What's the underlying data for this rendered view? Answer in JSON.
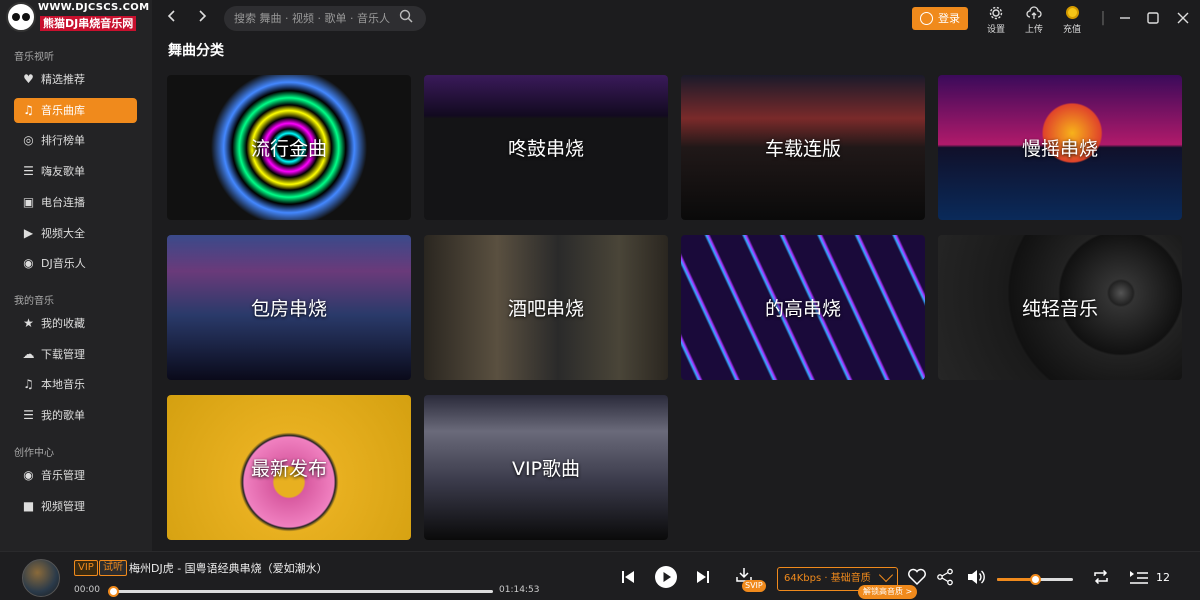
{
  "logo": {
    "url": "WWW.DJCSCS.COM",
    "name": "熊猫DJ串烧音乐网"
  },
  "sidebar": {
    "sections": [
      {
        "title": "音乐视听",
        "items": [
          {
            "label": "精选推荐",
            "icon": "heart-diamond-icon"
          },
          {
            "label": "音乐曲库",
            "icon": "music-note-icon",
            "active": true
          },
          {
            "label": "排行榜单",
            "icon": "medal-icon"
          },
          {
            "label": "嗨友歌单",
            "icon": "playlist-icon"
          },
          {
            "label": "电台连播",
            "icon": "radio-icon"
          },
          {
            "label": "视频大全",
            "icon": "video-icon"
          },
          {
            "label": "DJ音乐人",
            "icon": "turntable-icon"
          }
        ]
      },
      {
        "title": "我的音乐",
        "items": [
          {
            "label": "我的收藏",
            "icon": "star-icon"
          },
          {
            "label": "下载管理",
            "icon": "cloud-download-icon"
          },
          {
            "label": "本地音乐",
            "icon": "music-note-icon"
          },
          {
            "label": "我的歌单",
            "icon": "playlist-icon"
          }
        ]
      },
      {
        "title": "创作中心",
        "items": [
          {
            "label": "音乐管理",
            "icon": "disc-icon"
          },
          {
            "label": "视频管理",
            "icon": "camera-icon"
          }
        ]
      }
    ]
  },
  "topbar": {
    "search_placeholder": "搜索 舞曲 · 视频 · 歌单 · 音乐人",
    "login_label": "登录",
    "tools": [
      {
        "label": "设置",
        "icon": "gear-icon"
      },
      {
        "label": "上传",
        "icon": "upload-cloud-icon"
      },
      {
        "label": "充值",
        "icon": "coin-icon"
      }
    ]
  },
  "main": {
    "title": "舞曲分类",
    "categories": [
      {
        "label": "流行金曲",
        "theme": "neon-rings"
      },
      {
        "label": "咚鼓串烧",
        "theme": "purple-stage"
      },
      {
        "label": "车载连版",
        "theme": "car-sunset"
      },
      {
        "label": "慢摇串烧",
        "theme": "retro-sun-grid"
      },
      {
        "label": "包房串烧",
        "theme": "club-crowd"
      },
      {
        "label": "酒吧串烧",
        "theme": "bar-bottles"
      },
      {
        "label": "的高串烧",
        "theme": "neon-stripes"
      },
      {
        "label": "纯轻音乐",
        "theme": "vinyl-record"
      },
      {
        "label": "最新发布",
        "theme": "donut-pop"
      },
      {
        "label": "VIP歌曲",
        "theme": "concert-stage"
      }
    ]
  },
  "player": {
    "vip_tag": "VIP",
    "trial_tag": "试听",
    "song": "梅州DJ虎 - 国粤语经典串烧（爱如潮水）",
    "current_time": "00:00",
    "duration": "01:14:53",
    "progress": 0,
    "svip_badge": "SVIP",
    "quality": "64Kbps · 基础音质",
    "unlock_label": "解锁高音质 >",
    "volume": 0.5,
    "queue_count": "12",
    "colors": {
      "accent": "#f08a1c"
    }
  }
}
